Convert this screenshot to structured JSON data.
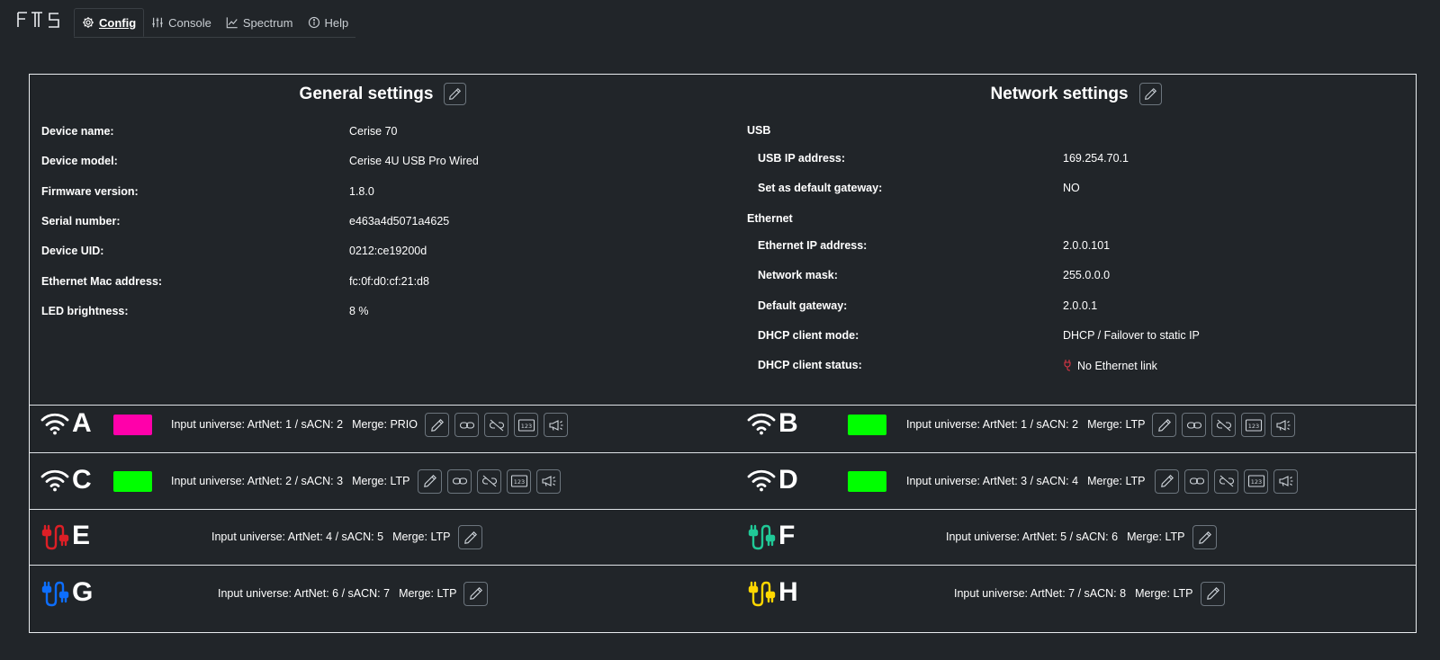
{
  "app": {
    "logo_text": "FTS"
  },
  "nav": {
    "tabs": [
      {
        "label": "Config",
        "icon": "gear-icon",
        "active": true
      },
      {
        "label": "Console",
        "icon": "sliders-icon",
        "active": false
      },
      {
        "label": "Spectrum",
        "icon": "chart-line-icon",
        "active": false
      },
      {
        "label": "Help",
        "icon": "info-icon",
        "active": false
      }
    ]
  },
  "general": {
    "title": "General settings",
    "rows": [
      {
        "label": "Device name:",
        "value": "Cerise 70"
      },
      {
        "label": "Device model:",
        "value": "Cerise 4U USB Pro Wired"
      },
      {
        "label": "Firmware version:",
        "value": "1.8.0"
      },
      {
        "label": "Serial number:",
        "value": "e463a4d5071a4625"
      },
      {
        "label": "Device UID:",
        "value": "0212:ce19200d"
      },
      {
        "label": "Ethernet Mac address:",
        "value": "fc:0f:d0:cf:21:d8"
      },
      {
        "label": "LED brightness:",
        "value": "8 %"
      }
    ]
  },
  "network": {
    "title": "Network settings",
    "usb_heading": "USB",
    "usb_rows": [
      {
        "label": "USB IP address:",
        "value": "169.254.70.1"
      },
      {
        "label": "Set as default gateway:",
        "value": "NO"
      }
    ],
    "eth_heading": "Ethernet",
    "eth_rows": [
      {
        "label": "Ethernet IP address:",
        "value": "2.0.0.101"
      },
      {
        "label": "Network mask:",
        "value": "255.0.0.0"
      },
      {
        "label": "Default gateway:",
        "value": "2.0.0.1"
      },
      {
        "label": "DHCP client mode:",
        "value": "DHCP / Failover to static IP"
      },
      {
        "label": "DHCP client status:",
        "value": "No Ethernet link",
        "icon": "unplugged-icon",
        "icon_color": "#dc3545"
      }
    ]
  },
  "universes": [
    {
      "letter": "A",
      "type": "wireless",
      "color": "#ff00aa",
      "input": "Input universe: ArtNet: 1 / sACN: 2",
      "merge": "Merge: PRIO"
    },
    {
      "letter": "B",
      "type": "wireless",
      "color": "#00ff00",
      "input": "Input universe: ArtNet: 1 / sACN: 2",
      "merge": "Merge: LTP"
    },
    {
      "letter": "C",
      "type": "wireless",
      "color": "#00ff00",
      "input": "Input universe: ArtNet: 2 / sACN: 3",
      "merge": "Merge: LTP"
    },
    {
      "letter": "D",
      "type": "wireless",
      "color": "#00ff00",
      "input": "Input universe: ArtNet: 3 / sACN: 4",
      "merge": "Merge: LTP"
    },
    {
      "letter": "E",
      "type": "wired",
      "color": "#dc1f26",
      "input": "Input universe: ArtNet: 4 / sACN: 5",
      "merge": "Merge: LTP"
    },
    {
      "letter": "F",
      "type": "wired",
      "color": "#20c997",
      "input": "Input universe: ArtNet: 5 / sACN: 6",
      "merge": "Merge: LTP"
    },
    {
      "letter": "G",
      "type": "wired",
      "color": "#0d6efd",
      "input": "Input universe: ArtNet: 6 / sACN: 7",
      "merge": "Merge: LTP"
    },
    {
      "letter": "H",
      "type": "wired",
      "color": "#ffd700",
      "input": "Input universe: ArtNet: 7 / sACN: 8",
      "merge": "Merge: LTP"
    }
  ]
}
